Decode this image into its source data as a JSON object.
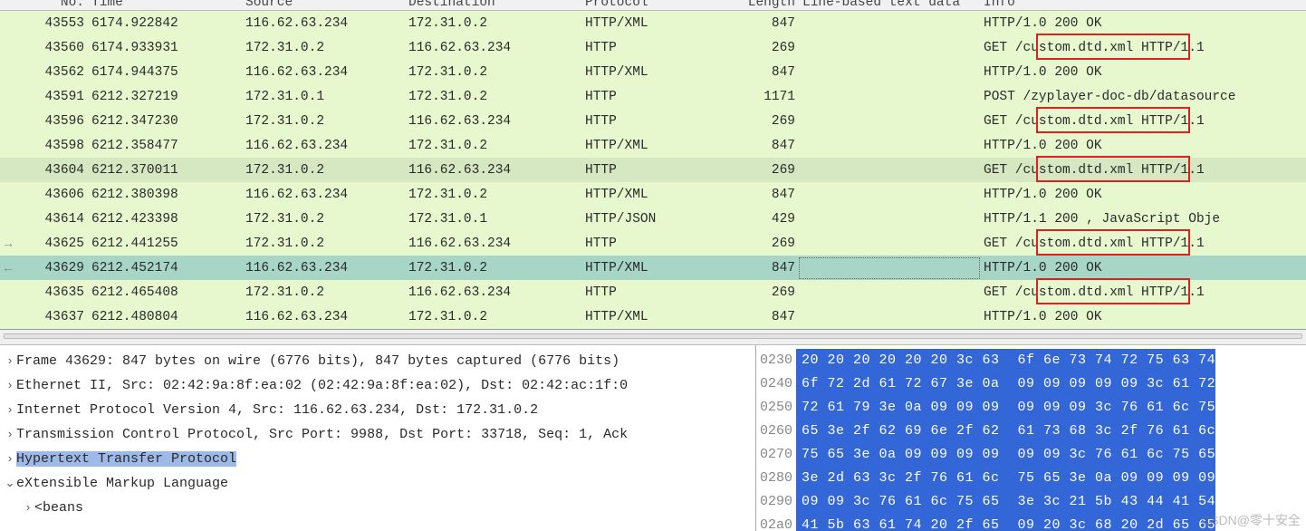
{
  "columns": {
    "no": "No.",
    "time": "Time",
    "source": "Source",
    "destination": "Destination",
    "protocol": "Protocol",
    "length": "Length",
    "lbd": "Line-based text data",
    "info": "Info"
  },
  "packets": [
    {
      "no": "43553",
      "time": "6174.922842",
      "src": "116.62.63.234",
      "dst": "172.31.0.2",
      "prot": "HTTP/XML",
      "len": "847",
      "info": "HTTP/1.0 200 OK",
      "cls": "green1"
    },
    {
      "no": "43560",
      "time": "6174.933931",
      "src": "172.31.0.2",
      "dst": "116.62.63.234",
      "prot": "HTTP",
      "len": "269",
      "info": "GET /custom.dtd.xml HTTP/1.1",
      "cls": "green1",
      "box": true
    },
    {
      "no": "43562",
      "time": "6174.944375",
      "src": "116.62.63.234",
      "dst": "172.31.0.2",
      "prot": "HTTP/XML",
      "len": "847",
      "info": "HTTP/1.0 200 OK",
      "cls": "green1"
    },
    {
      "no": "43591",
      "time": "6212.327219",
      "src": "172.31.0.1",
      "dst": "172.31.0.2",
      "prot": "HTTP",
      "len": "1171",
      "info": "POST /zyplayer-doc-db/datasource",
      "cls": "green1"
    },
    {
      "no": "43596",
      "time": "6212.347230",
      "src": "172.31.0.2",
      "dst": "116.62.63.234",
      "prot": "HTTP",
      "len": "269",
      "info": "GET /custom.dtd.xml HTTP/1.1",
      "cls": "green1",
      "box": true
    },
    {
      "no": "43598",
      "time": "6212.358477",
      "src": "116.62.63.234",
      "dst": "172.31.0.2",
      "prot": "HTTP/XML",
      "len": "847",
      "info": "HTTP/1.0 200 OK",
      "cls": "green1"
    },
    {
      "no": "43604",
      "time": "6212.370011",
      "src": "172.31.0.2",
      "dst": "116.62.63.234",
      "prot": "HTTP",
      "len": "269",
      "info": "GET /custom.dtd.xml HTTP/1.1",
      "cls": "green2",
      "box": true
    },
    {
      "no": "43606",
      "time": "6212.380398",
      "src": "116.62.63.234",
      "dst": "172.31.0.2",
      "prot": "HTTP/XML",
      "len": "847",
      "info": "HTTP/1.0 200 OK",
      "cls": "green1"
    },
    {
      "no": "43614",
      "time": "6212.423398",
      "src": "172.31.0.2",
      "dst": "172.31.0.1",
      "prot": "HTTP/JSON",
      "len": "429",
      "info": "HTTP/1.1 200  , JavaScript Obje",
      "cls": "green1"
    },
    {
      "no": "43625",
      "time": "6212.441255",
      "src": "172.31.0.2",
      "dst": "116.62.63.234",
      "prot": "HTTP",
      "len": "269",
      "info": "GET /custom.dtd.xml HTTP/1.1",
      "cls": "green1",
      "box": true,
      "arrow": "→"
    },
    {
      "no": "43629",
      "time": "6212.452174",
      "src": "116.62.63.234",
      "dst": "172.31.0.2",
      "prot": "HTTP/XML",
      "len": "847",
      "info": "HTTP/1.0 200 OK",
      "cls": "sel",
      "dotted": true,
      "arrow": "←"
    },
    {
      "no": "43635",
      "time": "6212.465408",
      "src": "172.31.0.2",
      "dst": "116.62.63.234",
      "prot": "HTTP",
      "len": "269",
      "info": "GET /custom.dtd.xml HTTP/1.1",
      "cls": "green1",
      "box": true
    },
    {
      "no": "43637",
      "time": "6212.480804",
      "src": "116.62.63.234",
      "dst": "172.31.0.2",
      "prot": "HTTP/XML",
      "len": "847",
      "info": "HTTP/1.0 200 OK",
      "cls": "green1"
    }
  ],
  "tree": [
    {
      "tw": "›",
      "text": "Frame 43629: 847 bytes on wire (6776 bits), 847 bytes captured (6776 bits)"
    },
    {
      "tw": "›",
      "text": "Ethernet II, Src: 02:42:9a:8f:ea:02 (02:42:9a:8f:ea:02), Dst: 02:42:ac:1f:0"
    },
    {
      "tw": "›",
      "text": "Internet Protocol Version 4, Src: 116.62.63.234, Dst: 172.31.0.2"
    },
    {
      "tw": "›",
      "text": "Transmission Control Protocol, Src Port: 9988, Dst Port: 33718, Seq: 1, Ack"
    },
    {
      "tw": "›",
      "text": "Hypertext Transfer Protocol",
      "sel": true
    },
    {
      "tw": "⌄",
      "text": "eXtensible Markup Language"
    },
    {
      "tw": "›",
      "text": "<beans",
      "indent": 1
    }
  ],
  "hex": [
    {
      "off": "0230",
      "l": "20 20 20 20 20 20 3c 63",
      "r": "6f 6e 73 74 72 75 63 74"
    },
    {
      "off": "0240",
      "l": "6f 72 2d 61 72 67 3e 0a",
      "r": "09 09 09 09 09 3c 61 72"
    },
    {
      "off": "0250",
      "l": "72 61 79 3e 0a 09 09 09",
      "r": "09 09 09 3c 76 61 6c 75"
    },
    {
      "off": "0260",
      "l": "65 3e 2f 62 69 6e 2f 62",
      "r": "61 73 68 3c 2f 76 61 6c"
    },
    {
      "off": "0270",
      "l": "75 65 3e 0a 09 09 09 09",
      "r": "09 09 3c 76 61 6c 75 65"
    },
    {
      "off": "0280",
      "l": "3e 2d 63 3c 2f 76 61 6c",
      "r": "75 65 3e 0a 09 09 09 09"
    },
    {
      "off": "0290",
      "l": "09 09 3c 76 61 6c 75 65",
      "r": "3e 3c 21 5b 43 44 41 54"
    },
    {
      "off": "02a0",
      "l": "41 5b 63 61 74 20 2f 65",
      "r": "09 20 3c 68 20 2d 65 65"
    }
  ],
  "watermark": "CSDN@零十安全"
}
